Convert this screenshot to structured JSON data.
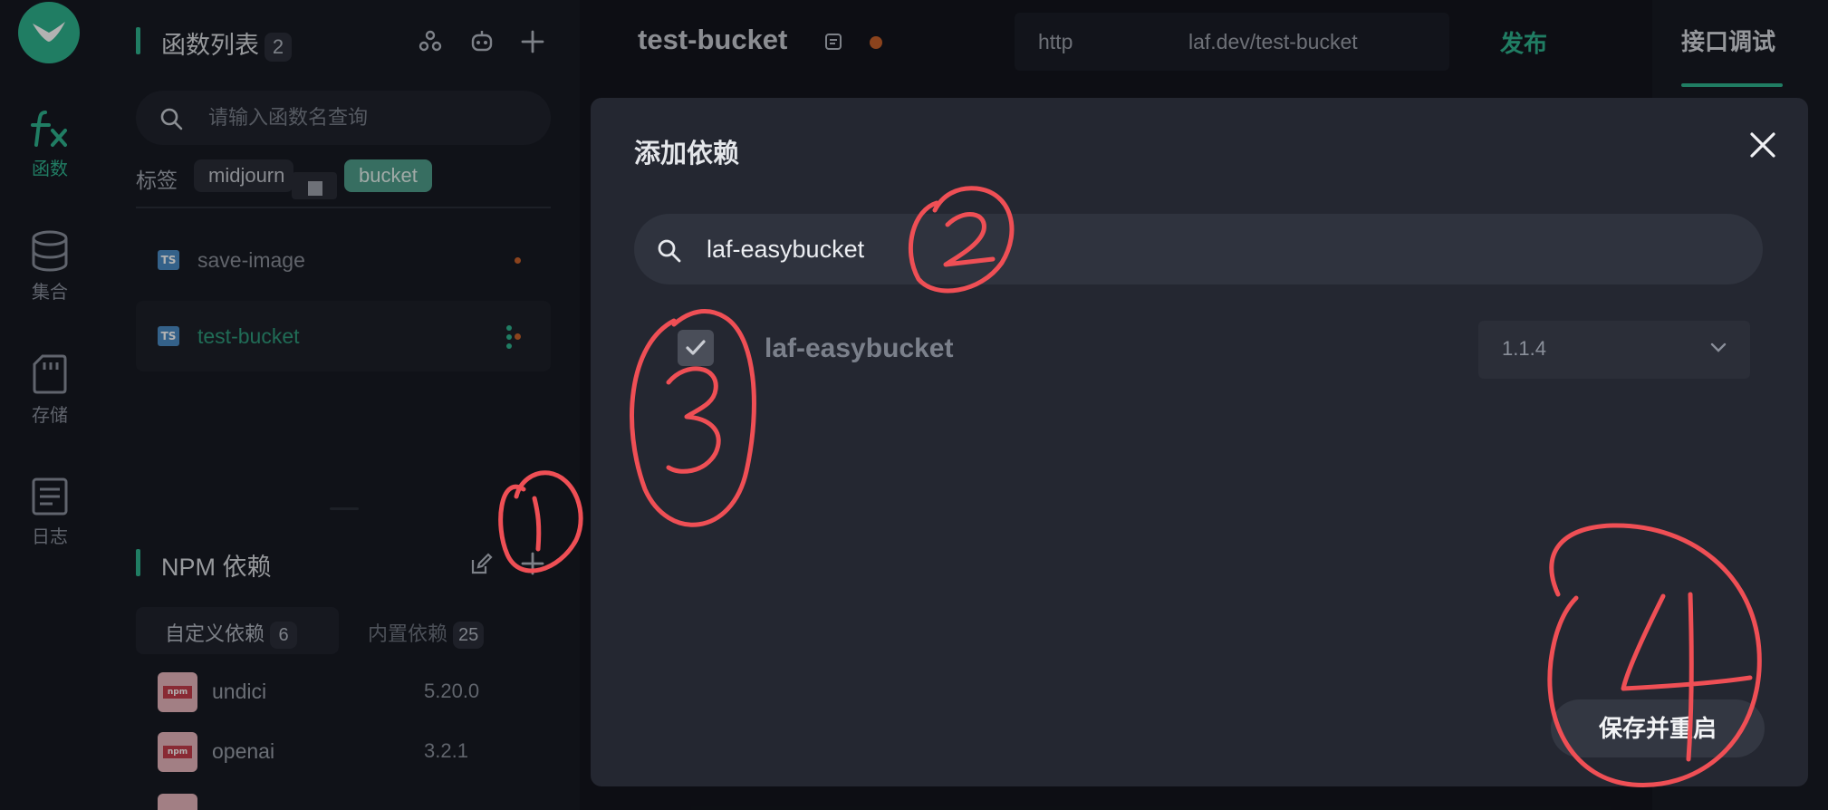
{
  "rail": {
    "items": [
      {
        "label": "函数",
        "icon": "function-icon"
      },
      {
        "label": "集合",
        "icon": "database-icon"
      },
      {
        "label": "存储",
        "icon": "storage-icon"
      },
      {
        "label": "日志",
        "icon": "log-icon"
      }
    ]
  },
  "functions": {
    "title": "函数列表",
    "count": "2",
    "search_placeholder": "请输入函数名查询",
    "tags_label": "标签",
    "tags": [
      "midjourn",
      "bucket"
    ],
    "items": [
      {
        "name": "save-image",
        "lang": "TS"
      },
      {
        "name": "test-bucket",
        "lang": "TS"
      }
    ]
  },
  "npm": {
    "title": "NPM 依赖",
    "tabs": [
      {
        "label": "自定义依赖",
        "count": "6"
      },
      {
        "label": "内置依赖",
        "count": "25"
      }
    ],
    "packages": [
      {
        "name": "undici",
        "version": "5.20.0"
      },
      {
        "name": "openai",
        "version": "3.2.1"
      }
    ],
    "icon_text": "npm"
  },
  "editor": {
    "file_title": "test-bucket",
    "url_prefix": "http",
    "url_suffix": "laf.dev/test-bucket",
    "publish_label": "发布",
    "right_tab": "接口调试"
  },
  "modal": {
    "title": "添加依赖",
    "search_value": "laf-easybucket",
    "package_name": "laf-easybucket",
    "version": "1.1.4",
    "save_label": "保存并重启"
  },
  "annotations": [
    "1",
    "2",
    "3",
    "4"
  ],
  "colors": {
    "accent": "#2fb38f",
    "annotation": "#ef4f55",
    "modified_dot": "#c8612a"
  }
}
